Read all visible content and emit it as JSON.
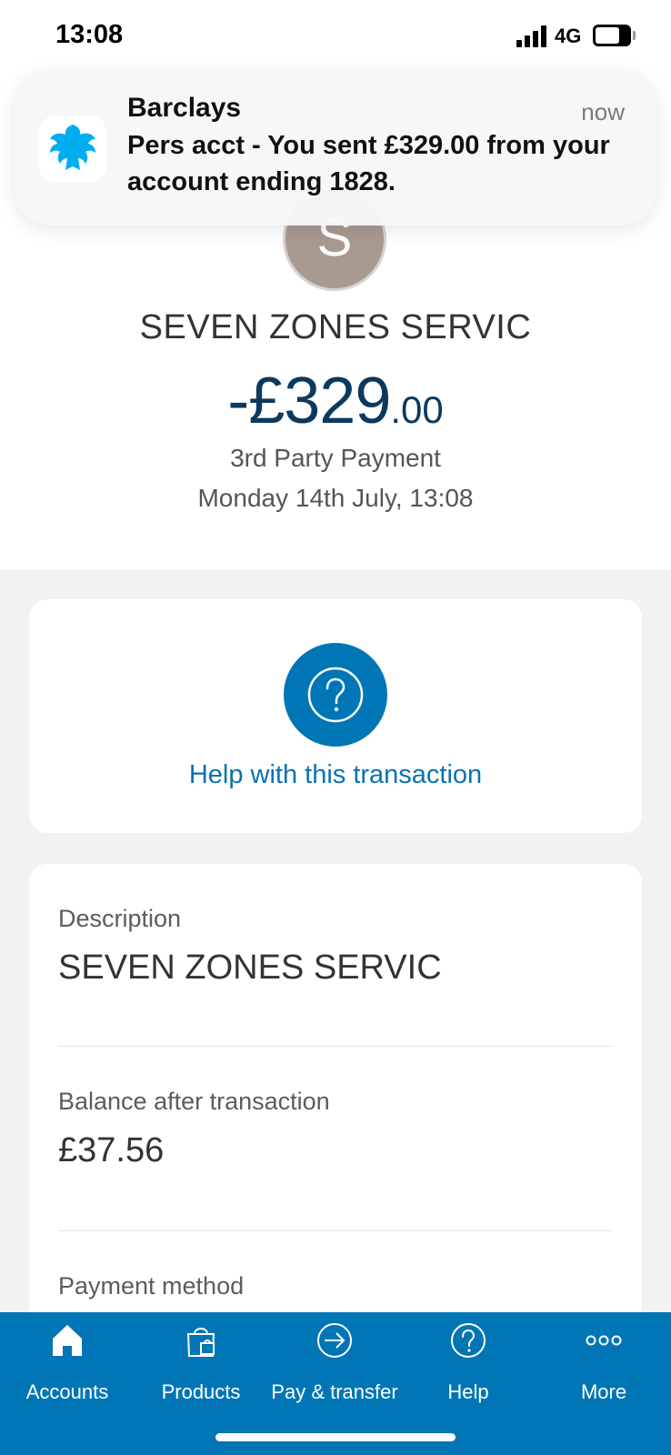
{
  "status_bar": {
    "time": "13:08",
    "network": "4G",
    "battery": "54"
  },
  "notification": {
    "app": "Barclays",
    "time": "now",
    "message": "Pers acct - You sent £329.00 from your account ending 1828."
  },
  "transaction": {
    "avatar_initial": "S",
    "merchant": "SEVEN ZONES SERVIC",
    "amount_main": "-£329",
    "amount_pence": ".00",
    "type": "3rd Party Payment",
    "date": "Monday 14th July, 13:08"
  },
  "help": {
    "label": "Help with this transaction"
  },
  "details": {
    "description_label": "Description",
    "description_value": "SEVEN ZONES SERVIC",
    "balance_label": "Balance after transaction",
    "balance_value": "£37.56",
    "payment_method_label": "Payment method"
  },
  "tabs": [
    {
      "label": "Accounts",
      "icon": "home-icon"
    },
    {
      "label": "Products",
      "icon": "shopping-bag-icon"
    },
    {
      "label": "Pay & transfer",
      "icon": "arrow-circle-icon"
    },
    {
      "label": "Help",
      "icon": "help-icon"
    },
    {
      "label": "More",
      "icon": "more-icon"
    }
  ],
  "colors": {
    "accent": "#0076b6",
    "amount": "#0c3a5e",
    "eagle": "#00aeef"
  }
}
